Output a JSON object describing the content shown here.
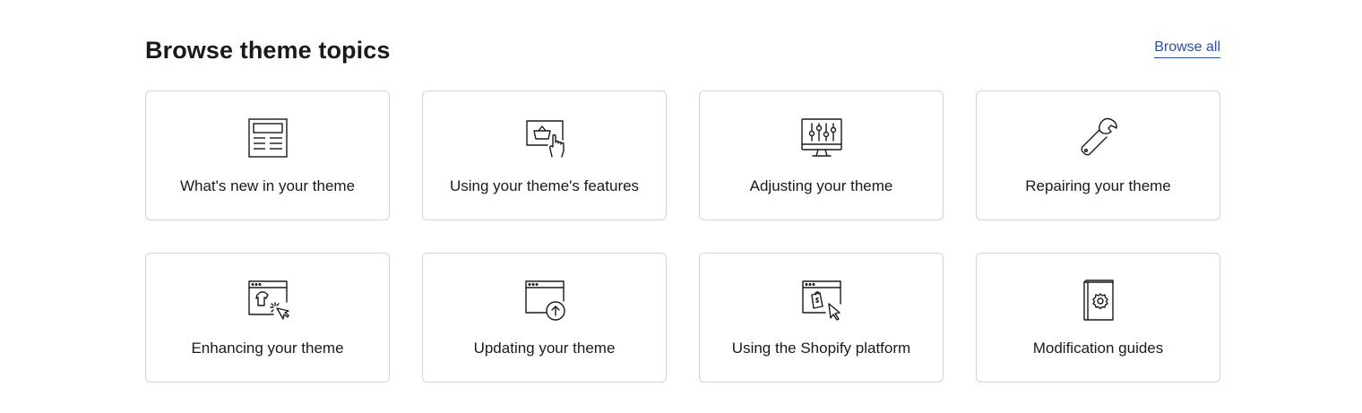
{
  "section": {
    "title": "Browse theme topics",
    "browse_all_label": "Browse all"
  },
  "cards": [
    {
      "label": "What's new in your theme",
      "icon": "newspaper-layout-icon"
    },
    {
      "label": "Using your theme's features",
      "icon": "shopping-basket-screen-icon"
    },
    {
      "label": "Adjusting your theme",
      "icon": "sliders-monitor-icon"
    },
    {
      "label": "Repairing your theme",
      "icon": "wrench-icon"
    },
    {
      "label": "Enhancing your theme",
      "icon": "browser-magic-click-icon"
    },
    {
      "label": "Updating your theme",
      "icon": "browser-upload-icon"
    },
    {
      "label": "Using the Shopify platform",
      "icon": "browser-shopify-cursor-icon"
    },
    {
      "label": "Modification guides",
      "icon": "gear-book-icon"
    }
  ]
}
